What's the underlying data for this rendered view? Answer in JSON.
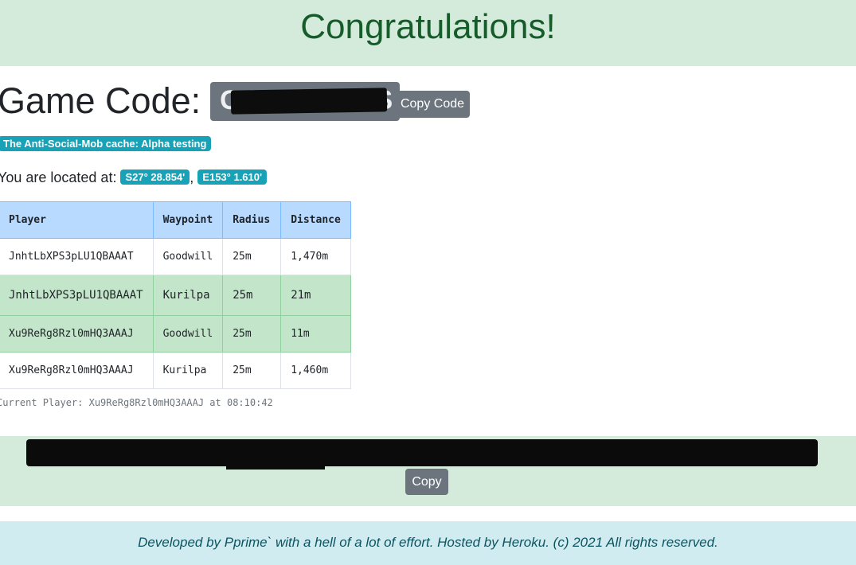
{
  "header": {
    "title": "Congratulations!"
  },
  "game_code": {
    "label": "Game Code:",
    "code": "GCALPHATS",
    "copy_label": "Copy Code"
  },
  "cache": {
    "badge": "The Anti-Social-Mob cache: Alpha testing"
  },
  "location": {
    "prefix": "You are located at:",
    "lat": "S27° 28.854'",
    "separator": ",",
    "lon": "E153° 1.610'"
  },
  "table": {
    "headers": [
      "Player",
      "Waypoint",
      "Radius",
      "Distance"
    ],
    "rows": [
      {
        "player": "JnhtLbXPS3pLU1QBAAAT",
        "waypoint": "Goodwill",
        "radius": "25m",
        "distance": "1,470m"
      },
      {
        "player": "JnhtLbXPS3pLU1QBAAAT",
        "waypoint": "Kurilpa",
        "radius": "25m",
        "distance": "21m"
      },
      {
        "player": "Xu9ReRg8Rzl0mHQ3AAAJ",
        "waypoint": "Goodwill",
        "radius": "25m",
        "distance": "11m"
      },
      {
        "player": "Xu9ReRg8Rzl0mHQ3AAAJ",
        "waypoint": "Kurilpa",
        "radius": "25m",
        "distance": "1,460m"
      }
    ]
  },
  "current_player": "Current Player: Xu9ReRg8Rzl0mHQ3AAAJ at 08:10:42",
  "share": {
    "copy_label": "Copy"
  },
  "footer": {
    "text": "Developed by Pprime` with a hell of a lot of effort. Hosted by Heroku. (c) 2021 All rights reserved."
  },
  "colors": {
    "success_bg": "#d4ebdb",
    "primary_header": "#b8daff",
    "info_badge": "#17a2b8",
    "secondary_btn": "#6c757d",
    "footer_bg": "#d1ecf1"
  }
}
